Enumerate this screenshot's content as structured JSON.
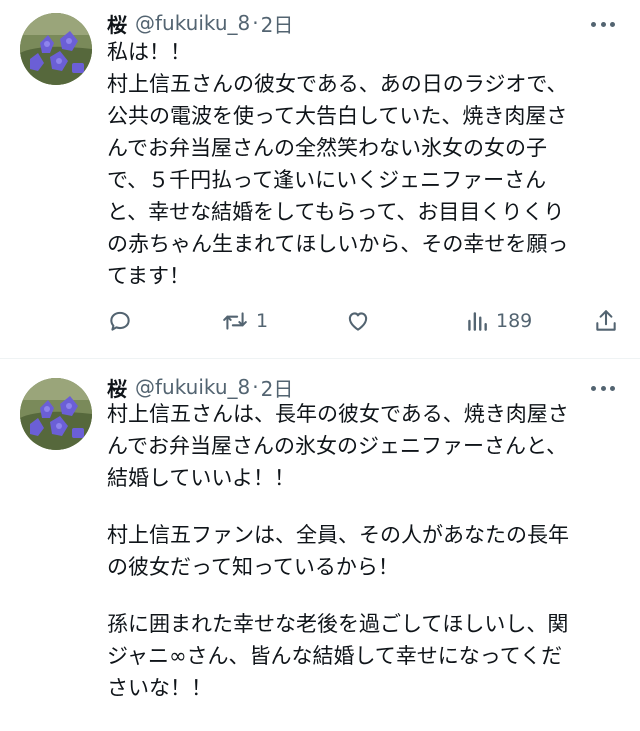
{
  "tweets": [
    {
      "author": {
        "name": "桜",
        "handle": "@fukuiku_8",
        "separator": "·",
        "time": "2日"
      },
      "lines": [
        "私は！！",
        "村上信五さんの彼女である、あの日のラジオで、",
        "公共の電波を使って大告白していた、焼き肉屋さ",
        "んでお弁当屋さんの全然笑わない氷女の女の子",
        "で、５千円払って逢いにいくジェニファーさん",
        "と、幸せな結婚をしてもらって、お目目くりくり",
        "の赤ちゃん生まれてほしいから、その幸せを願っ",
        "てます！"
      ],
      "stats": {
        "replies": "",
        "retweets": "1",
        "likes": "",
        "views": "189"
      },
      "icons": [
        "reply-icon",
        "retweet-icon",
        "like-icon",
        "views-icon",
        "share-icon"
      ]
    },
    {
      "author": {
        "name": "桜",
        "handle": "@fukuiku_8",
        "separator": "·",
        "time": "2日"
      },
      "paragraphs": [
        [
          "村上信五さんは、長年の彼女である、焼き肉屋さ",
          "んでお弁当屋さんの氷女のジェニファーさんと、",
          "結婚していいよ！！"
        ],
        [
          "村上信五ファンは、全員、その人があなたの長年",
          "の彼女だって知っているから！"
        ],
        [
          "孫に囲まれた幸せな老後を過ごしてほしいし、関",
          "ジャニ∞さん、皆んな結婚して幸せになってくだ",
          "さいな！！"
        ]
      ]
    }
  ],
  "colors": {
    "text": "#0f1419",
    "secondary": "#536471",
    "divider": "#eff3f4",
    "background": "#ffffff"
  }
}
